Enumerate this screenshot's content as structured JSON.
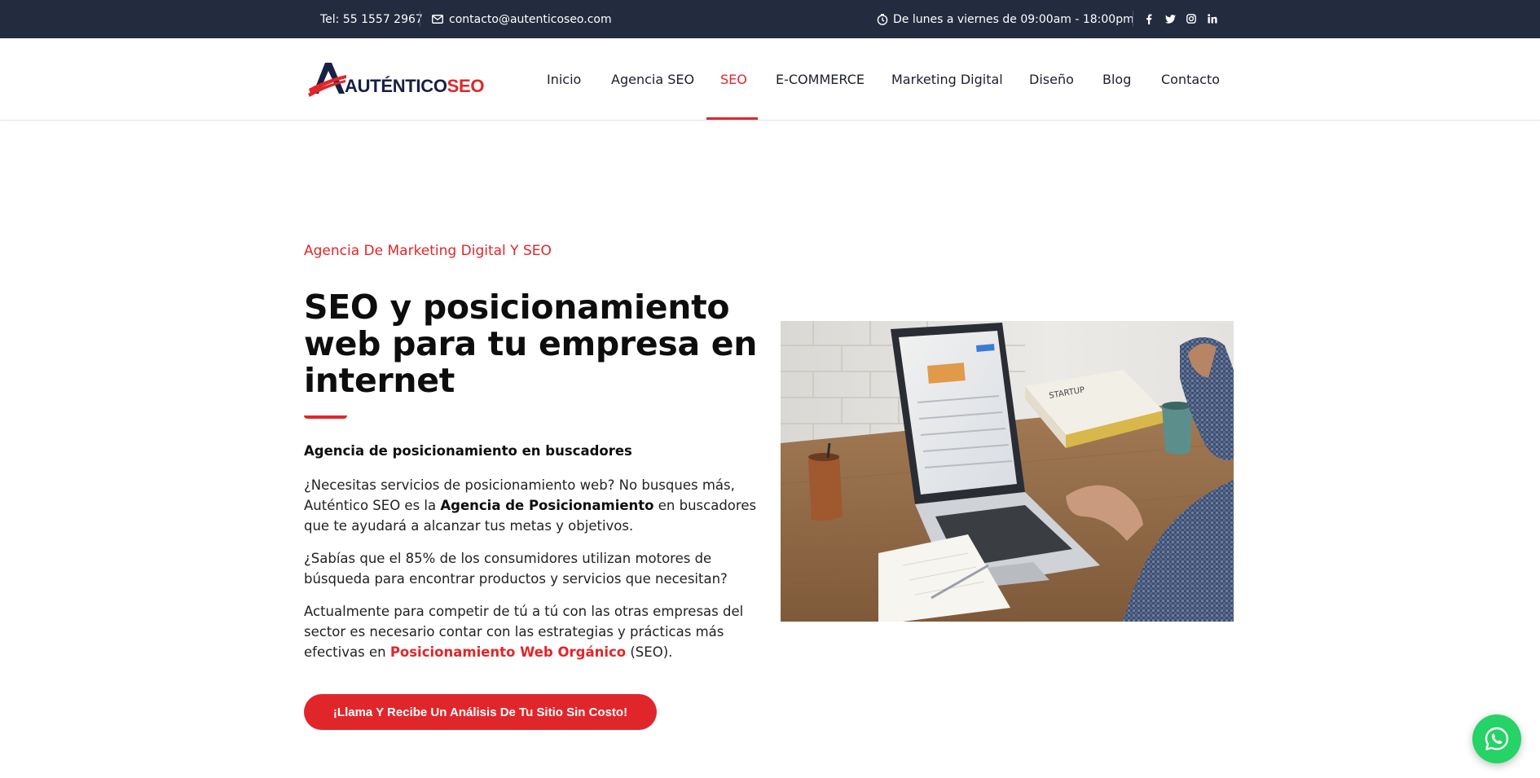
{
  "topbar": {
    "phone": "Tel: 55 1557 2967",
    "email": "contacto@autenticoseo.com",
    "hours": "De lunes a viernes de 09:00am - 18:00pm",
    "social": [
      "facebook-icon",
      "twitter-icon",
      "instagram-icon",
      "linkedin-icon"
    ]
  },
  "logo": {
    "part1": "AUTÉNTICO",
    "part2": "SEO"
  },
  "nav": {
    "items": [
      "Inicio",
      "Agencia SEO",
      "SEO",
      "E-COMMERCE",
      "Marketing Digital",
      "Diseño",
      "Blog",
      "Contacto"
    ],
    "active": "SEO"
  },
  "hero": {
    "eyebrow": "Agencia De Marketing Digital Y SEO",
    "title": "SEO y posicionamiento web para tu empresa en internet",
    "subheading": "Agencia de posicionamiento en buscadores",
    "p1_a": "¿Necesitas servicios de posicionamiento web? No busques más, Auténtico SEO es la ",
    "p1_bold": "Agencia de Posicionamiento",
    "p1_b": " en buscadores que te ayudará a alcanzar tus metas y objetivos.",
    "p2": "¿Sabías que el 85% de los consumidores utilizan motores de búsqueda para encontrar productos y servicios que necesitan?",
    "p3_a": "Actualmente para competir de tú a tú con las otras empresas del sector es necesario contar con las estrategias y prácticas más efectivas en ",
    "p3_link": "Posicionamiento Web Orgánico",
    "p3_b": " (SEO).",
    "cta": "¡Llama Y Recibe Un Análisis De Tu Sitio Sin Costo!"
  },
  "colors": {
    "accent": "#e1262b",
    "topbar_bg": "#232b3e",
    "brand_dark": "#172145",
    "whatsapp": "#25d366"
  }
}
